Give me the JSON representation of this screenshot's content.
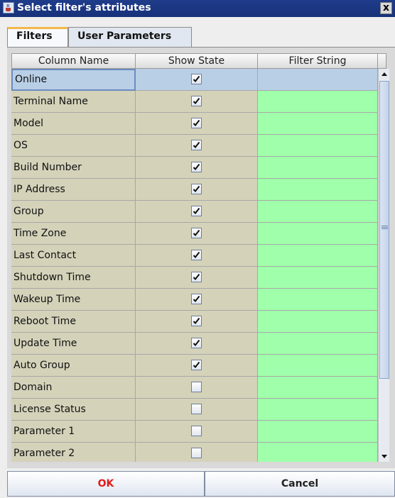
{
  "window": {
    "title": "Select filter's attributes",
    "close_label": "x"
  },
  "tabs": [
    {
      "label": "Filters",
      "active": true
    },
    {
      "label": "User Parameters",
      "active": false
    }
  ],
  "table": {
    "columns": [
      "Column Name",
      "Show State",
      "Filter String"
    ],
    "rows": [
      {
        "name": "Online",
        "show": true,
        "filter": "",
        "selected": true
      },
      {
        "name": "Terminal Name",
        "show": true,
        "filter": ""
      },
      {
        "name": "Model",
        "show": true,
        "filter": ""
      },
      {
        "name": "OS",
        "show": true,
        "filter": ""
      },
      {
        "name": "Build Number",
        "show": true,
        "filter": ""
      },
      {
        "name": "IP Address",
        "show": true,
        "filter": ""
      },
      {
        "name": "Group",
        "show": true,
        "filter": ""
      },
      {
        "name": "Time Zone",
        "show": true,
        "filter": ""
      },
      {
        "name": "Last Contact",
        "show": true,
        "filter": ""
      },
      {
        "name": "Shutdown Time",
        "show": true,
        "filter": ""
      },
      {
        "name": "Wakeup Time",
        "show": true,
        "filter": ""
      },
      {
        "name": "Reboot Time",
        "show": true,
        "filter": ""
      },
      {
        "name": "Update Time",
        "show": true,
        "filter": ""
      },
      {
        "name": "Auto Group",
        "show": true,
        "filter": ""
      },
      {
        "name": "Domain",
        "show": false,
        "filter": ""
      },
      {
        "name": "License Status",
        "show": false,
        "filter": ""
      },
      {
        "name": "Parameter 1",
        "show": false,
        "filter": ""
      },
      {
        "name": "Parameter 2",
        "show": false,
        "filter": ""
      }
    ]
  },
  "buttons": {
    "ok": "OK",
    "cancel": "Cancel"
  },
  "colors": {
    "titlebar": "#1f3c8a",
    "ok_text": "#e01b1b",
    "filter_cell": "#9fffaa",
    "name_cell": "#d4d2b9",
    "tab_accent": "#f2b84b"
  },
  "icons": {
    "app": "java-cup-icon",
    "close": "close-icon",
    "check": "checkmark-icon",
    "scroll_up": "arrow-up-icon",
    "scroll_down": "arrow-down-icon"
  }
}
